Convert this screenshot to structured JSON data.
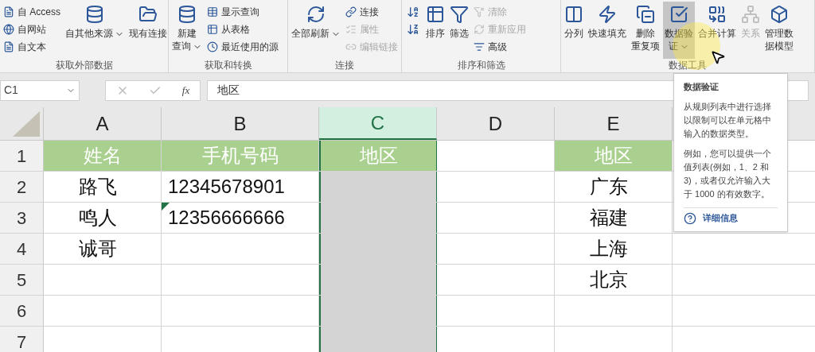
{
  "ribbon": {
    "groups": [
      {
        "label": "获取外部数据",
        "items": [
          {
            "kind": "small",
            "label": "自 Access",
            "disabled": false
          },
          {
            "kind": "small",
            "label": "自网站",
            "disabled": false
          },
          {
            "kind": "small",
            "label": "自文本",
            "disabled": false
          },
          {
            "kind": "large",
            "lines": [
              "自其他来源"
            ],
            "dropdown": true,
            "disabled": false,
            "hovered": false
          },
          {
            "kind": "large",
            "lines": [
              "现有连接"
            ],
            "dropdown": false,
            "disabled": false,
            "hovered": false
          }
        ]
      },
      {
        "label": "获取和转换",
        "items": [
          {
            "kind": "large",
            "lines": [
              "新建",
              "查询"
            ],
            "dropdown": true,
            "disabled": false,
            "hovered": false
          },
          {
            "kind": "small",
            "label": "显示查询",
            "disabled": false
          },
          {
            "kind": "small",
            "label": "从表格",
            "disabled": false
          },
          {
            "kind": "small",
            "label": "最近使用的源",
            "disabled": false
          }
        ]
      },
      {
        "label": "连接",
        "items": [
          {
            "kind": "large",
            "lines": [
              "全部刷新"
            ],
            "dropdown": true,
            "disabled": false,
            "hovered": false
          },
          {
            "kind": "small",
            "label": "连接",
            "disabled": false
          },
          {
            "kind": "small",
            "label": "属性",
            "disabled": true
          },
          {
            "kind": "small",
            "label": "编辑链接",
            "disabled": true
          }
        ]
      },
      {
        "label": "排序和筛选",
        "items": [
          {
            "kind": "sort_icon"
          },
          {
            "kind": "sort_icon"
          },
          {
            "kind": "large",
            "lines": [
              "排序"
            ],
            "dropdown": false,
            "disabled": false,
            "hovered": false
          },
          {
            "kind": "large",
            "lines": [
              "筛选"
            ],
            "dropdown": false,
            "disabled": false,
            "hovered": false
          },
          {
            "kind": "small",
            "label": "清除",
            "disabled": true
          },
          {
            "kind": "small",
            "label": "重新应用",
            "disabled": true
          },
          {
            "kind": "small",
            "label": "高级",
            "disabled": false
          }
        ]
      },
      {
        "label": "数据工具",
        "items": [
          {
            "kind": "large",
            "lines": [
              "分列"
            ],
            "dropdown": false,
            "disabled": false,
            "hovered": false
          },
          {
            "kind": "large",
            "lines": [
              "快速填充"
            ],
            "dropdown": false,
            "disabled": false,
            "hovered": false
          },
          {
            "kind": "large",
            "lines": [
              "删除",
              "重复项"
            ],
            "dropdown": false,
            "disabled": false,
            "hovered": false
          },
          {
            "kind": "large",
            "lines": [
              "数据验",
              "证"
            ],
            "dropdown": true,
            "disabled": false,
            "hovered": true
          },
          {
            "kind": "large",
            "lines": [
              "合并计算"
            ],
            "dropdown": false,
            "disabled": false,
            "hovered": false
          },
          {
            "kind": "large",
            "lines": [
              "关系"
            ],
            "dropdown": false,
            "disabled": true,
            "hovered": false
          },
          {
            "kind": "large",
            "lines": [
              "管理数",
              "据模型"
            ],
            "dropdown": false,
            "disabled": false,
            "hovered": false
          }
        ]
      }
    ]
  },
  "formula_bar": {
    "name_box": "C1",
    "function_label": "fx",
    "formula": "地区"
  },
  "sheet": {
    "columns": [
      {
        "label": "A",
        "selected": false
      },
      {
        "label": "B",
        "selected": false
      },
      {
        "label": "C",
        "selected": true
      },
      {
        "label": "D",
        "selected": false
      },
      {
        "label": "E",
        "selected": false
      }
    ],
    "rows": [
      {
        "number": "1",
        "cells": [
          {
            "value": "姓名",
            "kind": "header"
          },
          {
            "value": "手机号码",
            "kind": "header"
          },
          {
            "value": "地区",
            "kind": "header"
          },
          {
            "kind": "plain"
          },
          {
            "value": "地区",
            "kind": "header"
          }
        ]
      },
      {
        "number": "2",
        "cells": [
          {
            "value": "路飞",
            "kind": "plain"
          },
          {
            "value": "12345678901",
            "kind": "plain"
          },
          {
            "kind": "plain"
          },
          {
            "kind": "plain"
          },
          {
            "value": "广东",
            "kind": "plain"
          }
        ]
      },
      {
        "number": "3",
        "cells": [
          {
            "value": "鸣人",
            "kind": "plain"
          },
          {
            "value": "12356666666",
            "kind": "plain",
            "error_marker": true
          },
          {
            "kind": "plain"
          },
          {
            "kind": "plain"
          },
          {
            "value": "福建",
            "kind": "plain"
          }
        ]
      },
      {
        "number": "4",
        "cells": [
          {
            "value": "诚哥",
            "kind": "plain"
          },
          {
            "kind": "plain"
          },
          {
            "kind": "plain"
          },
          {
            "kind": "plain"
          },
          {
            "value": "上海",
            "kind": "plain"
          }
        ]
      },
      {
        "number": "5",
        "cells": [
          {
            "kind": "plain"
          },
          {
            "kind": "plain"
          },
          {
            "kind": "plain"
          },
          {
            "kind": "plain"
          },
          {
            "value": "北京",
            "kind": "plain"
          }
        ]
      },
      {
        "number": "6",
        "cells": [
          {
            "kind": "plain"
          },
          {
            "kind": "plain"
          },
          {
            "kind": "plain"
          },
          {
            "kind": "plain"
          },
          {
            "kind": "plain"
          }
        ]
      },
      {
        "number": "7",
        "cells": [
          {
            "kind": "plain"
          },
          {
            "kind": "plain"
          },
          {
            "kind": "plain"
          },
          {
            "kind": "plain"
          },
          {
            "kind": "plain"
          }
        ]
      }
    ]
  },
  "tooltip": {
    "title": "数据验证",
    "paragraphs": [
      "从规则列表中进行选择以限制可以在单元格中输入的数据类型。",
      "例如，您可以提供一个值列表(例如，1、2 和 3)，或者仅允许输入大于 1000 的有效数字。"
    ],
    "link": "详细信息"
  }
}
